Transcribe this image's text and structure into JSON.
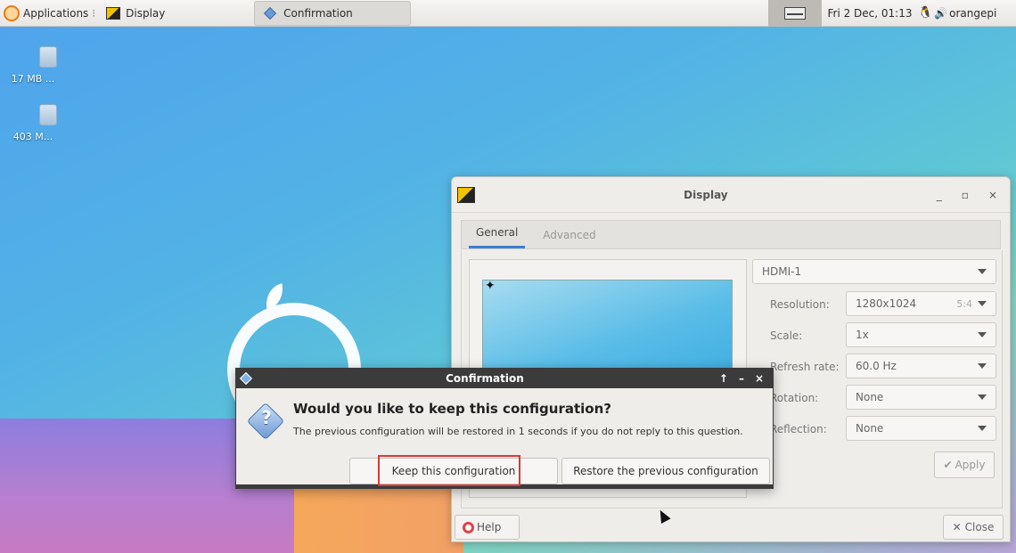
{
  "panel": {
    "apps_label": "Applications",
    "tasks": [
      {
        "label": "Display"
      },
      {
        "label": "Confirmation"
      }
    ],
    "clock": "Fri  2 Dec, 01:13",
    "user": "orangepi"
  },
  "desktop": {
    "icons": [
      {
        "label": "17 MB ..."
      },
      {
        "label": "403 M..."
      }
    ]
  },
  "display_window": {
    "title": "Display",
    "tabs": [
      {
        "label": "General",
        "active": true
      },
      {
        "label": "Advanced",
        "active": false
      }
    ],
    "output": "HDMI-1",
    "settings": [
      {
        "label": "Resolution:",
        "value": "1280x1024",
        "extra": "5:4"
      },
      {
        "label": "Scale:",
        "value": "1x"
      },
      {
        "label": "Refresh rate:",
        "value": "60.0 Hz"
      },
      {
        "label": "Rotation:",
        "value": "None"
      },
      {
        "label": "Reflection:",
        "value": "None"
      }
    ],
    "apply_label": "Apply",
    "help_label": "Help",
    "close_label": "Close",
    "minimize": "_",
    "maximize": "▫",
    "close_x": "×"
  },
  "confirmation": {
    "title": "Confirmation",
    "heading": "Would you like to keep this configuration?",
    "message": "The previous configuration will be restored in 1 seconds if you do not reply to this question.",
    "keep_label": "Keep this configuration",
    "restore_label": "Restore the previous configuration",
    "ctrl_up": "↑",
    "ctrl_min": "–",
    "ctrl_close": "×"
  },
  "colors": {
    "accent": "#3b7fd5",
    "highlight": "#d63a3a",
    "dialog_title_bg": "#3b3b3b"
  }
}
